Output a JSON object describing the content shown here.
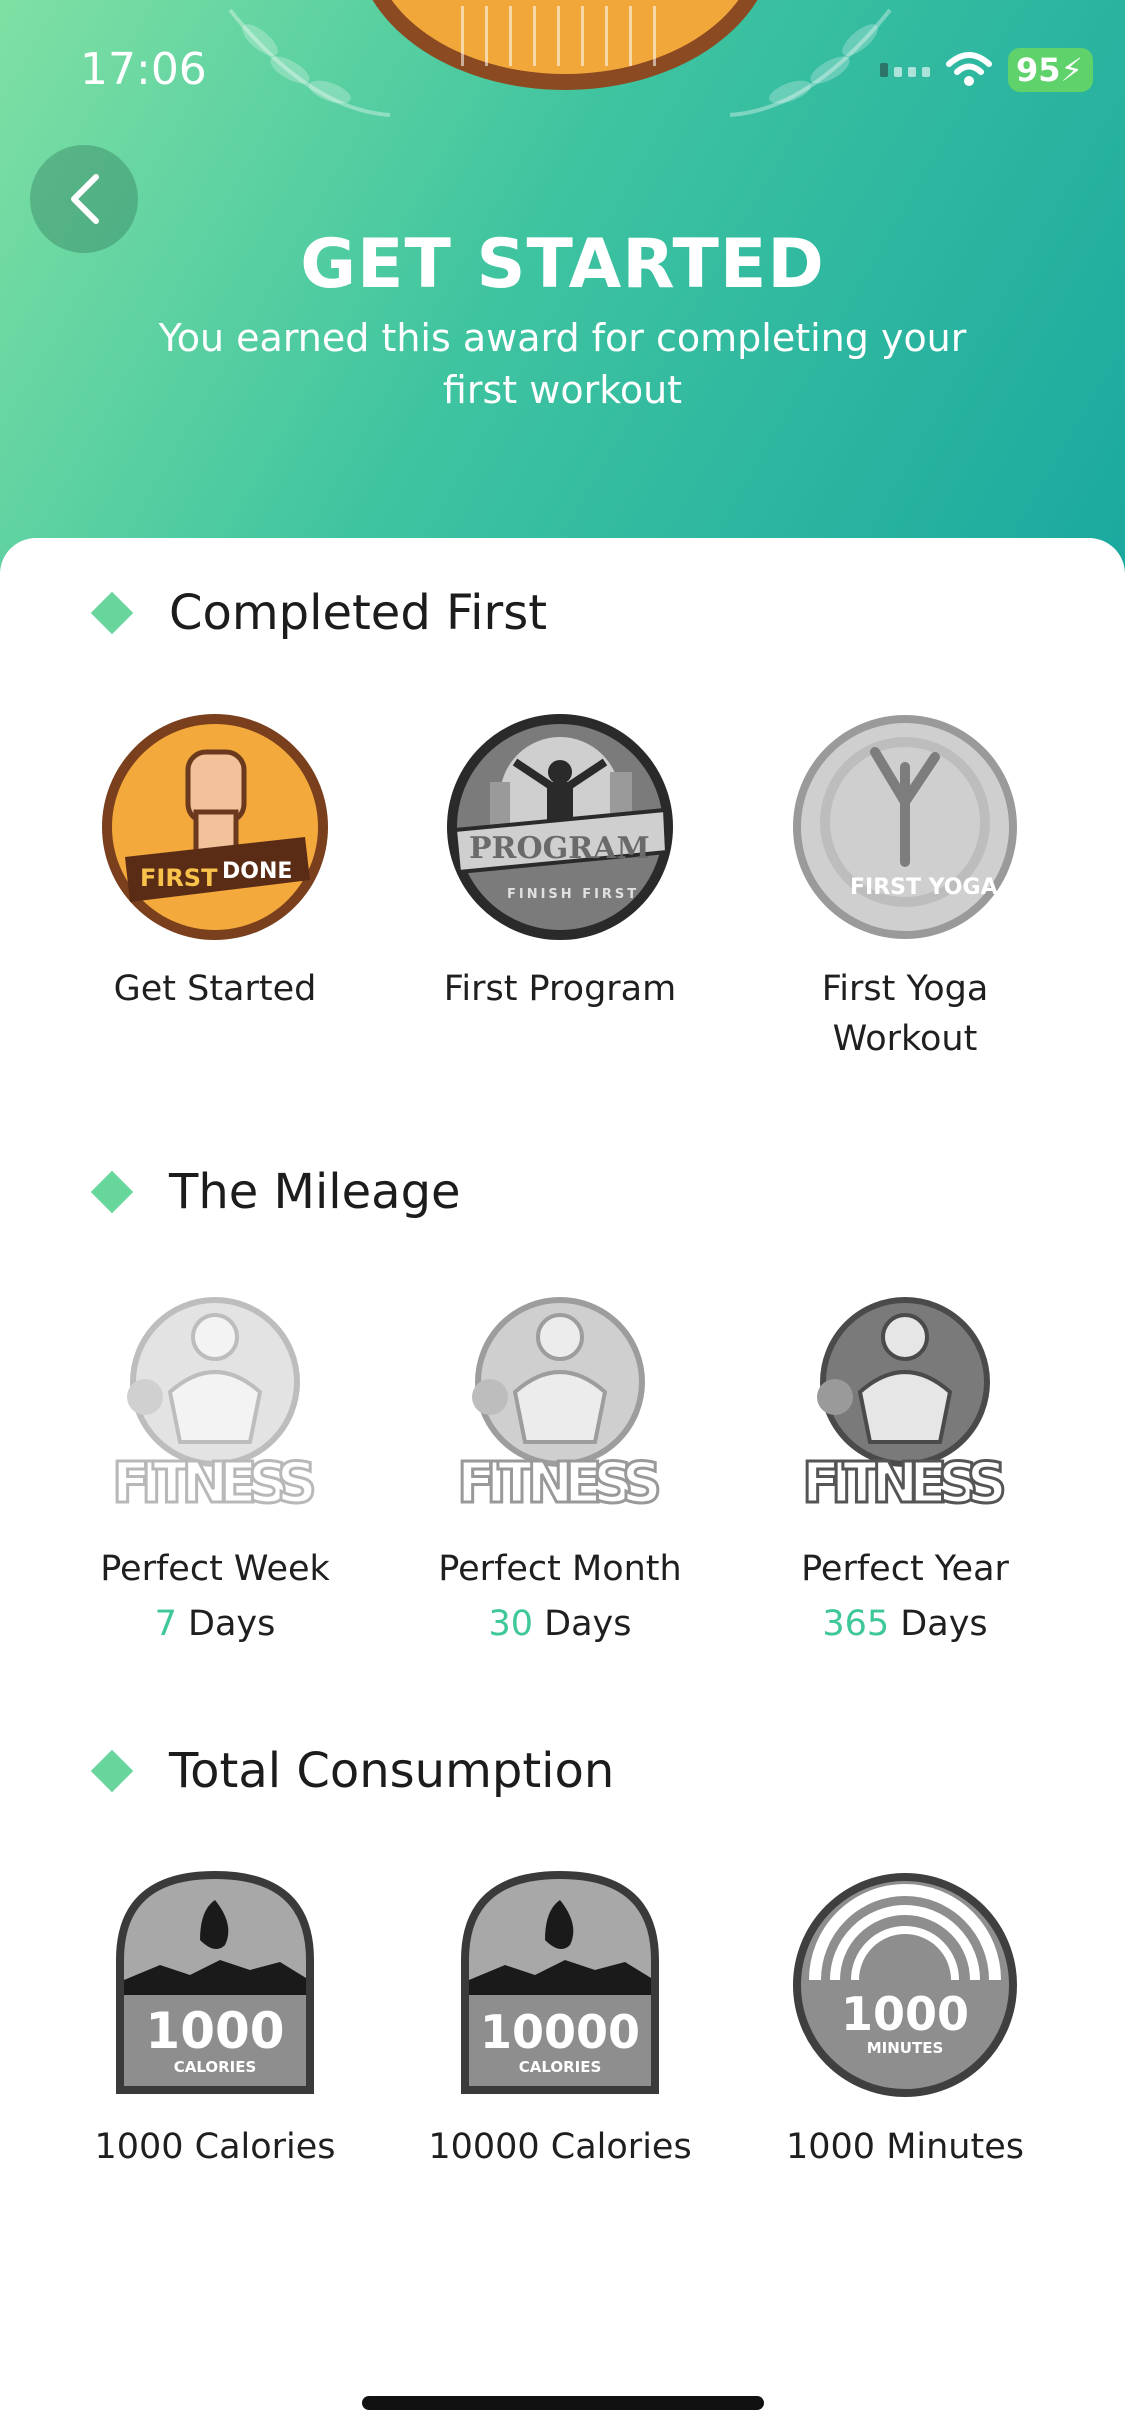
{
  "status": {
    "time": "17:06",
    "battery": "95"
  },
  "hero": {
    "title": "GET STARTED",
    "subtitle": "You earned this award for completing your first workout"
  },
  "sections": [
    {
      "title": "Completed First",
      "badges": [
        {
          "label": "Get Started",
          "icon": "first-done-fist-icon",
          "caption_art": [
            "FIRST",
            "DONE"
          ]
        },
        {
          "label": "First Program",
          "icon": "program-finish-first-icon",
          "caption_art": [
            "PROGRAM",
            "FINISH FIRST"
          ]
        },
        {
          "label": "First Yoga Workout",
          "icon": "first-yoga-icon",
          "caption_art": [
            "FIRST YOGA"
          ]
        }
      ]
    },
    {
      "title": "The Mileage",
      "badges": [
        {
          "label": "Perfect Week",
          "count": "7",
          "unit": "Days",
          "icon": "fitness-bodybuilder-icon",
          "caption_art": [
            "FITNESS"
          ]
        },
        {
          "label": "Perfect Month",
          "count": "30",
          "unit": "Days",
          "icon": "fitness-bodybuilder-icon",
          "caption_art": [
            "FITNESS"
          ]
        },
        {
          "label": "Perfect Year",
          "count": "365",
          "unit": "Days",
          "icon": "fitness-bodybuilder-icon",
          "caption_art": [
            "FITNESS"
          ]
        }
      ]
    },
    {
      "title": "Total Consumption",
      "badges": [
        {
          "label": "1000 Calories",
          "icon": "calories-flame-icon",
          "caption_art": [
            "1000",
            "CALORIES"
          ]
        },
        {
          "label": "10000 Calories",
          "icon": "calories-flame-icon",
          "caption_art": [
            "10000",
            "CALORIES"
          ]
        },
        {
          "label": "1000 Minutes",
          "icon": "minutes-rainbow-icon",
          "caption_art": [
            "1000",
            "MINUTES"
          ]
        }
      ]
    }
  ],
  "colors": {
    "accent": "#3ec79a",
    "diamond": "#68d59d"
  }
}
